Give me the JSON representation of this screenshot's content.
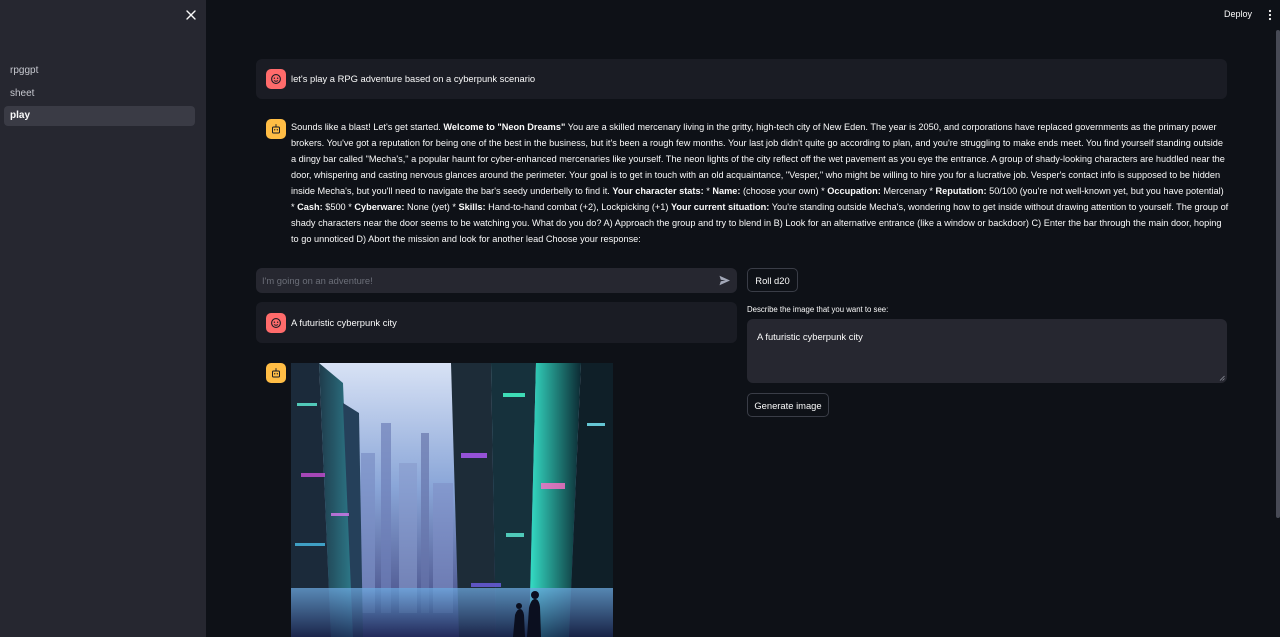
{
  "sidebar": {
    "items": [
      {
        "label": "rpggpt",
        "active": false
      },
      {
        "label": "sheet",
        "active": false
      },
      {
        "label": "play",
        "active": true
      }
    ]
  },
  "header": {
    "deploy_label": "Deploy"
  },
  "chat": {
    "user_message_1": "let's play a RPG adventure based on a cyberpunk scenario",
    "assistant_message_1": [
      {
        "t": "Sounds like a blast! Let's get started. "
      },
      {
        "t": "Welcome to \"Neon Dreams\"",
        "b": true
      },
      {
        "t": " You are a skilled mercenary living in the gritty, high-tech city of New Eden. The year is 2050, and corporations have replaced governments as the primary power brokers. You've got a reputation for being one of the best in the business, but it's been a rough few months. Your last job didn't quite go according to plan, and you're struggling to make ends meet. You find yourself standing outside a dingy bar called \"Mecha's,\" a popular haunt for cyber-enhanced mercenaries like yourself. The neon lights of the city reflect off the wet pavement as you eye the entrance. A group of shady-looking characters are huddled near the door, whispering and casting nervous glances around the perimeter. Your goal is to get in touch with an old acquaintance, \"Vesper,\" who might be willing to hire you for a lucrative job. Vesper's contact info is supposed to be hidden inside Mecha's, but you'll need to navigate the bar's seedy underbelly to find it. "
      },
      {
        "t": "Your character stats:",
        "b": true
      },
      {
        "t": " * "
      },
      {
        "t": "Name:",
        "b": true
      },
      {
        "t": " (choose your own) * "
      },
      {
        "t": "Occupation:",
        "b": true
      },
      {
        "t": " Mercenary * "
      },
      {
        "t": "Reputation:",
        "b": true
      },
      {
        "t": " 50/100 (you're not well-known yet, but you have potential) * "
      },
      {
        "t": "Cash:",
        "b": true
      },
      {
        "t": " $500 * "
      },
      {
        "t": "Cyberware:",
        "b": true
      },
      {
        "t": " None (yet) * "
      },
      {
        "t": "Skills:",
        "b": true
      },
      {
        "t": " Hand-to-hand combat (+2), Lockpicking (+1) "
      },
      {
        "t": "Your current situation:",
        "b": true
      },
      {
        "t": " You're standing outside Mecha's, wondering how to get inside without drawing attention to yourself. The group of shady characters near the door seems to be watching you. What do you do? A) Approach the group and try to blend in B) Look for an alternative entrance (like a window or backdoor) C) Enter the bar through the main door, hoping to go unnoticed D) Abort the mission and look for another lead Choose your response:"
      }
    ],
    "input_placeholder": "I'm going on an adventure!",
    "user_message_2": "A futuristic cyberpunk city"
  },
  "controls": {
    "roll_label": "Roll d20",
    "describe_label": "Describe the image that you want to see:",
    "describe_value": "A futuristic cyberpunk city",
    "generate_label": "Generate image"
  },
  "colors": {
    "background": "#0e1117",
    "sidebar": "#262730",
    "user_avatar": "#ff6b6b",
    "bot_avatar": "#ffbd45"
  },
  "icons": {
    "close": "close-icon",
    "send": "send-icon",
    "menu": "kebab-menu-icon",
    "user": "user-avatar-icon",
    "bot": "bot-avatar-icon"
  }
}
